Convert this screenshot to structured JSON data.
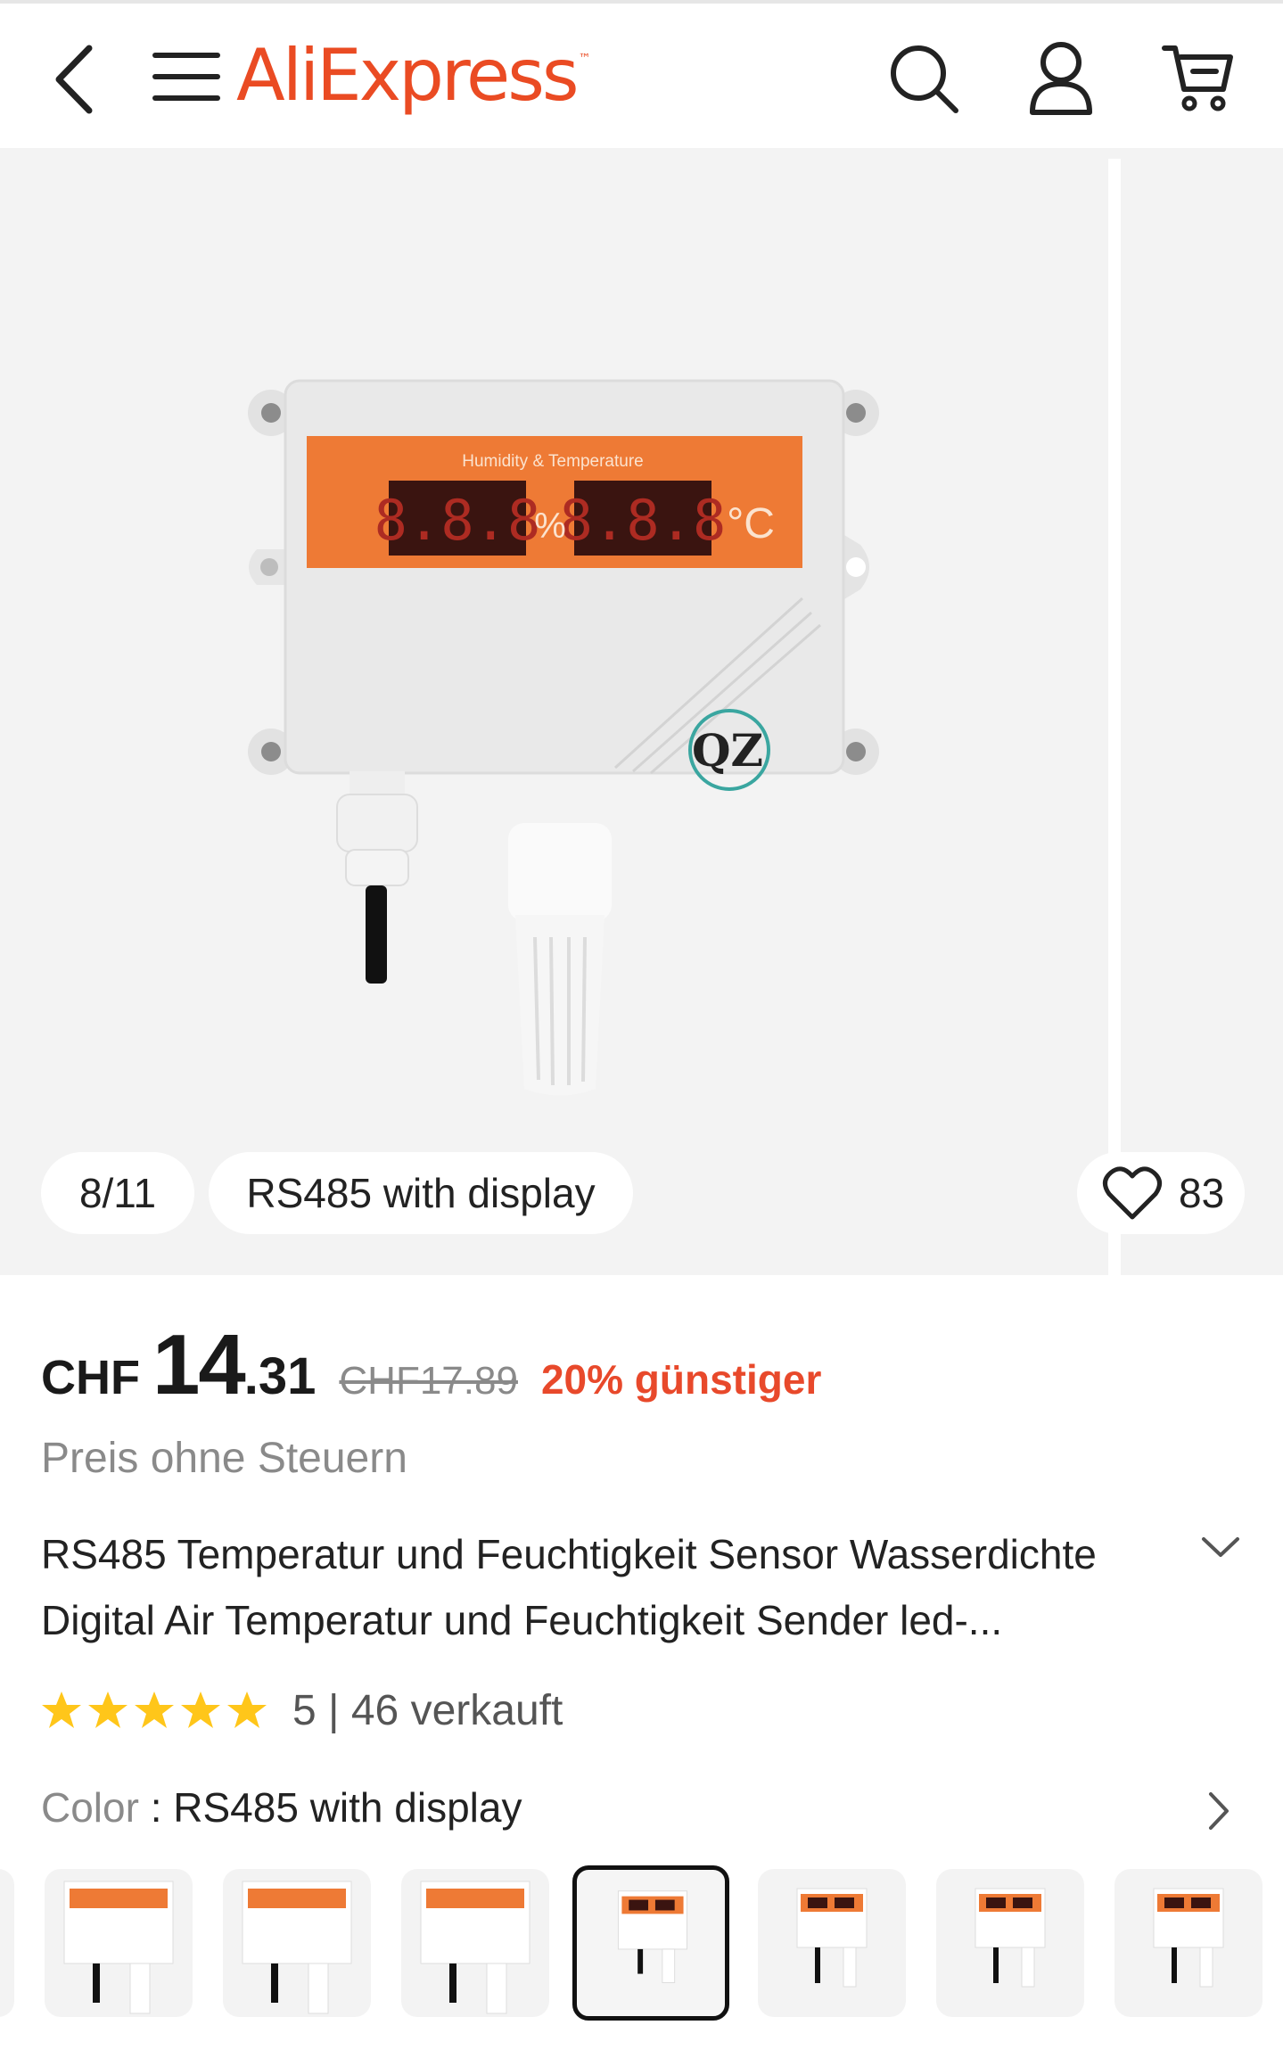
{
  "header": {
    "logo_text": "AliExpress",
    "logo_tm": "™",
    "accent_color": "#ea4b23"
  },
  "gallery": {
    "position": "8/11",
    "variant_label": "RS485 with display",
    "favorites_count": "83",
    "display_header": "Humidity & Temperature",
    "display_digits": "8.8.8",
    "percent_symbol": "%",
    "celsius_symbol": "°C",
    "brand_mark": "QZ"
  },
  "price": {
    "currency": "CHF",
    "whole": "14",
    "cents": ".31",
    "original": "CHF17.89",
    "discount": "20% günstiger",
    "tax_note": "Preis ohne Steuern"
  },
  "product": {
    "title": "RS485 Temperatur und Feuchtigkeit Sensor Wasserdichte Digital Air Temperatur und Feuchtigkeit Sender led-..."
  },
  "rating": {
    "stars": 5,
    "summary": "5 | 46 verkauft"
  },
  "color": {
    "label": "Color",
    "separator": " : ",
    "value": "RS485 with display"
  },
  "thumbnails": {
    "selected_index": 3,
    "count_visible": 7
  }
}
